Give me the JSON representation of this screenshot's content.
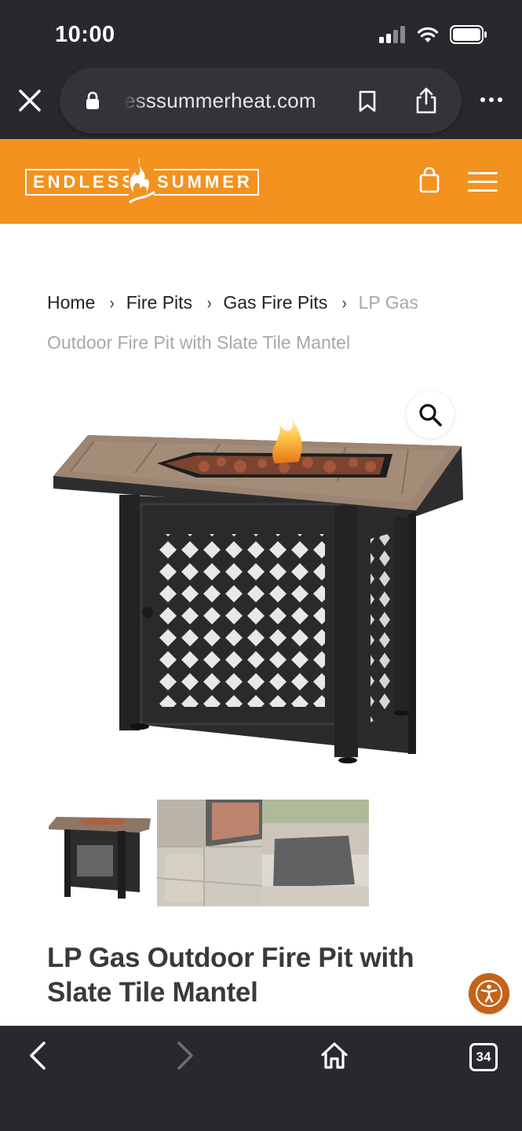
{
  "status_bar": {
    "time": "10:00",
    "icons": [
      "signal-icon",
      "wifi-icon",
      "battery-icon"
    ]
  },
  "browser": {
    "url": "esssummerheat.com",
    "icons": [
      "close-icon",
      "lock-icon",
      "bookmark-icon",
      "share-icon",
      "more-icon"
    ]
  },
  "site_header": {
    "logo_left": "ENDLESS",
    "logo_right": "SUMMER",
    "brand_color": "#f3921f",
    "icons": [
      "shopping-bag-icon",
      "hamburger-menu-icon"
    ]
  },
  "breadcrumb": {
    "items": [
      "Home",
      "Fire Pits",
      "Gas Fire Pits"
    ],
    "separator": "›",
    "current": "LP Gas Outdoor Fire Pit with Slate Tile Mantel"
  },
  "product": {
    "title": "LP Gas Outdoor Fire Pit with Slate Tile Mantel",
    "thumbnail_count": 3
  },
  "toolbar": {
    "tab_count": "34",
    "icons": [
      "back-icon",
      "forward-icon",
      "home-icon",
      "tabs-icon"
    ]
  },
  "accessibility": {
    "accent_color": "#c4621a",
    "icon": "accessibility-icon"
  }
}
